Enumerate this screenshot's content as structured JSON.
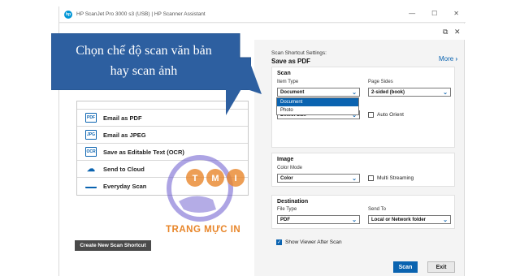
{
  "window": {
    "title": "HP ScanJet Pro 3000 s3 (USB) | HP Scanner Assistant",
    "minimize": "—",
    "maximize": "☐",
    "close": "✕"
  },
  "callout": {
    "line1": "Chọn chế độ scan văn bản",
    "line2": "hay scan ảnh"
  },
  "shortcuts": [
    {
      "icon": "email-pdf-icon",
      "icon_text": "PDF",
      "label": "Email as PDF"
    },
    {
      "icon": "email-jpeg-icon",
      "icon_text": "JPG",
      "label": "Email as JPEG"
    },
    {
      "icon": "ocr-icon",
      "icon_text": "OCR",
      "label": "Save as Editable Text (OCR)"
    },
    {
      "icon": "cloud-icon",
      "icon_text": "☁",
      "label": "Send to Cloud"
    },
    {
      "icon": "everyday-scan-icon",
      "icon_text": "",
      "label": "Everyday Scan"
    }
  ],
  "new_shortcut_label": "Create New Scan Shortcut",
  "settings": {
    "caption": "Scan Shortcut Settings:",
    "title": "Save as PDF",
    "more_label": "More"
  },
  "scan_panel": {
    "title": "Scan",
    "item_type_label": "Item Type",
    "item_type_value": "Document",
    "page_sides_label": "Page Sides",
    "page_sides_value": "2-sided (book)",
    "size_value": "Detect Size",
    "auto_orient_label": "Auto Orient",
    "dropdown_options": [
      "Document",
      "Photo"
    ],
    "dropdown_selected": "Document"
  },
  "image_panel": {
    "title": "Image",
    "color_mode_label": "Color Mode",
    "color_mode_value": "Color",
    "multi_streaming_label": "Multi Streaming"
  },
  "destination_panel": {
    "title": "Destination",
    "file_type_label": "File Type",
    "file_type_value": "PDF",
    "send_to_label": "Send To",
    "send_to_value": "Local or Network folder"
  },
  "show_viewer_label": "Show Viewer After Scan",
  "buttons": {
    "scan": "Scan",
    "exit": "Exit"
  },
  "watermark": {
    "letters": [
      "T",
      "M",
      "I"
    ],
    "caption": "TRANG MỰC IN"
  },
  "colors": {
    "accent": "#0a63b0",
    "callout": "#2d5fa0",
    "watermark_orange": "#e8862a",
    "watermark_purple": "#6a5acd"
  }
}
